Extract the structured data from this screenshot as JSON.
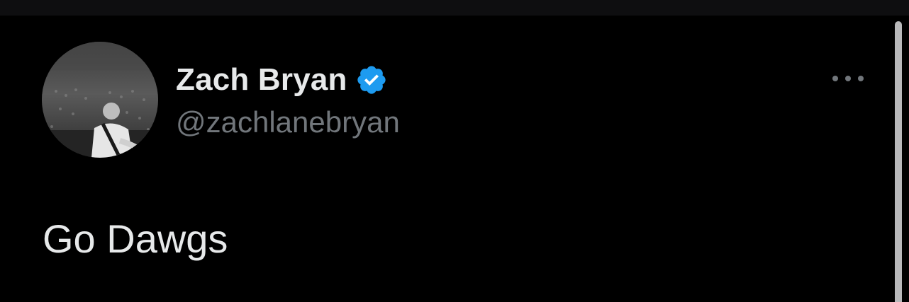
{
  "tweet": {
    "author": {
      "name": "Zach Bryan",
      "handle": "@zachlanebryan",
      "verified": true
    },
    "text": "Go Dawgs",
    "more_icon": "more-horizontal-icon",
    "verified_icon": "verified-badge-icon"
  },
  "colors": {
    "background": "#000000",
    "primary_text": "#e7e9ea",
    "secondary_text": "#71767b",
    "verified_blue": "#1d9bf0"
  }
}
